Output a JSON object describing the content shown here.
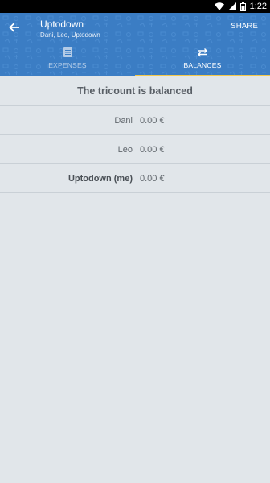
{
  "status_bar": {
    "time": "1:22"
  },
  "header": {
    "title": "Uptodown",
    "subtitle": "Dani, Leo, Uptodown",
    "share_label": "SHARE"
  },
  "tabs": [
    {
      "label": "EXPENSES",
      "icon": "list-icon",
      "active": false
    },
    {
      "label": "BALANCES",
      "icon": "swap-arrows-icon",
      "active": true
    }
  ],
  "balances": {
    "status_text": "The tricount is balanced",
    "rows": [
      {
        "name": "Dani",
        "amount": "0.00 €",
        "is_me": false
      },
      {
        "name": "Leo",
        "amount": "0.00 €",
        "is_me": false
      },
      {
        "name": "Uptodown (me)",
        "amount": "0.00 €",
        "is_me": true
      }
    ]
  },
  "colors": {
    "header_blue": "#3b7dc4",
    "tab_indicator": "#f3c84a",
    "background": "#e1e6ea"
  }
}
